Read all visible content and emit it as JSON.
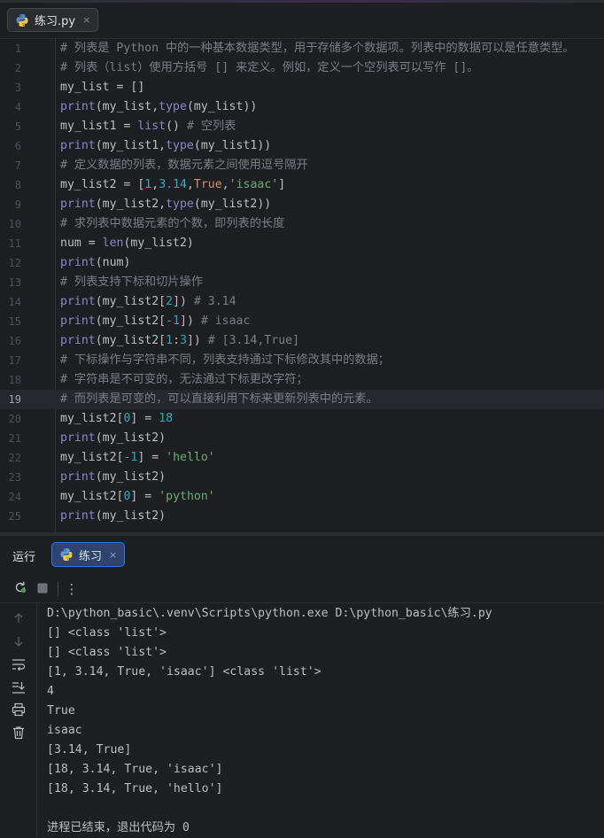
{
  "editor": {
    "tab_label": "练习.py",
    "tab_close": "×",
    "current_line": 19,
    "lines": [
      {
        "num": "1",
        "tokens": [
          {
            "t": "# 列表是 Python 中的一种基本数据类型，用于存储多个数据项。列表中的数据可以是任意类型。",
            "k": "c"
          }
        ]
      },
      {
        "num": "2",
        "tokens": [
          {
            "t": "# 列表（list）使用方括号 [] 来定义。例如，定义一个空列表可以写作 []。",
            "k": "c"
          }
        ]
      },
      {
        "num": "3",
        "tokens": [
          {
            "t": "my_list = []",
            "k": ""
          }
        ]
      },
      {
        "num": "4",
        "tokens": [
          {
            "t": "print",
            "k": "b"
          },
          {
            "t": "(my_list,",
            "k": ""
          },
          {
            "t": "type",
            "k": "b"
          },
          {
            "t": "(my_list))",
            "k": ""
          }
        ]
      },
      {
        "num": "5",
        "tokens": [
          {
            "t": "my_list1 = ",
            "k": ""
          },
          {
            "t": "list",
            "k": "b"
          },
          {
            "t": "() ",
            "k": ""
          },
          {
            "t": "# 空列表",
            "k": "c"
          }
        ]
      },
      {
        "num": "6",
        "tokens": [
          {
            "t": "print",
            "k": "b"
          },
          {
            "t": "(my_list1,",
            "k": ""
          },
          {
            "t": "type",
            "k": "b"
          },
          {
            "t": "(my_list1))",
            "k": ""
          }
        ]
      },
      {
        "num": "7",
        "tokens": [
          {
            "t": "# 定义数据的列表，数据元素之间使用逗号隔开",
            "k": "c"
          }
        ]
      },
      {
        "num": "8",
        "tokens": [
          {
            "t": "my_list2 = [",
            "k": ""
          },
          {
            "t": "1",
            "k": "n"
          },
          {
            "t": ",",
            "k": ""
          },
          {
            "t": "3.14",
            "k": "n"
          },
          {
            "t": ",",
            "k": ""
          },
          {
            "t": "True",
            "k": "k"
          },
          {
            "t": ",",
            "k": ""
          },
          {
            "t": "'isaac'",
            "k": "s"
          },
          {
            "t": "]",
            "k": ""
          }
        ]
      },
      {
        "num": "9",
        "tokens": [
          {
            "t": "print",
            "k": "b"
          },
          {
            "t": "(my_list2,",
            "k": ""
          },
          {
            "t": "type",
            "k": "b"
          },
          {
            "t": "(my_list2))",
            "k": ""
          }
        ]
      },
      {
        "num": "10",
        "tokens": [
          {
            "t": "# 求列表中数据元素的个数，即列表的长度",
            "k": "c"
          }
        ]
      },
      {
        "num": "11",
        "tokens": [
          {
            "t": "num = ",
            "k": ""
          },
          {
            "t": "len",
            "k": "b"
          },
          {
            "t": "(my_list2)",
            "k": ""
          }
        ]
      },
      {
        "num": "12",
        "tokens": [
          {
            "t": "print",
            "k": "b"
          },
          {
            "t": "(num)",
            "k": ""
          }
        ]
      },
      {
        "num": "13",
        "tokens": [
          {
            "t": "# 列表支持下标和切片操作",
            "k": "c"
          }
        ]
      },
      {
        "num": "14",
        "tokens": [
          {
            "t": "print",
            "k": "b"
          },
          {
            "t": "(my_list2[",
            "k": ""
          },
          {
            "t": "2",
            "k": "n"
          },
          {
            "t": "]) ",
            "k": ""
          },
          {
            "t": "# 3.14",
            "k": "c"
          }
        ]
      },
      {
        "num": "15",
        "tokens": [
          {
            "t": "print",
            "k": "b"
          },
          {
            "t": "(my_list2[",
            "k": ""
          },
          {
            "t": "-1",
            "k": "n"
          },
          {
            "t": "]) ",
            "k": ""
          },
          {
            "t": "# isaac",
            "k": "c"
          }
        ]
      },
      {
        "num": "16",
        "tokens": [
          {
            "t": "print",
            "k": "b"
          },
          {
            "t": "(my_list2[",
            "k": ""
          },
          {
            "t": "1",
            "k": "n"
          },
          {
            "t": ":",
            "k": ""
          },
          {
            "t": "3",
            "k": "n"
          },
          {
            "t": "]) ",
            "k": ""
          },
          {
            "t": "# [3.14,True]",
            "k": "c"
          }
        ]
      },
      {
        "num": "17",
        "tokens": [
          {
            "t": "# 下标操作与字符串不同，列表支持通过下标修改其中的数据；",
            "k": "c"
          }
        ]
      },
      {
        "num": "18",
        "tokens": [
          {
            "t": "# 字符串是不可变的，无法通过下标更改字符；",
            "k": "c"
          }
        ]
      },
      {
        "num": "19",
        "tokens": [
          {
            "t": "# 而列表是可变的，可以直接利用下标来更新列表中的元素。",
            "k": "c"
          }
        ]
      },
      {
        "num": "20",
        "tokens": [
          {
            "t": "my_list2[",
            "k": ""
          },
          {
            "t": "0",
            "k": "n"
          },
          {
            "t": "] = ",
            "k": ""
          },
          {
            "t": "18",
            "k": "n"
          }
        ]
      },
      {
        "num": "21",
        "tokens": [
          {
            "t": "print",
            "k": "b"
          },
          {
            "t": "(my_list2)",
            "k": ""
          }
        ]
      },
      {
        "num": "22",
        "tokens": [
          {
            "t": "my_list2[",
            "k": ""
          },
          {
            "t": "-1",
            "k": "n"
          },
          {
            "t": "] = ",
            "k": ""
          },
          {
            "t": "'hello'",
            "k": "s"
          }
        ]
      },
      {
        "num": "23",
        "tokens": [
          {
            "t": "print",
            "k": "b"
          },
          {
            "t": "(my_list2)",
            "k": ""
          }
        ]
      },
      {
        "num": "24",
        "tokens": [
          {
            "t": "my_list2[",
            "k": ""
          },
          {
            "t": "0",
            "k": "n"
          },
          {
            "t": "] = ",
            "k": ""
          },
          {
            "t": "'python'",
            "k": "s"
          }
        ]
      },
      {
        "num": "25",
        "tokens": [
          {
            "t": "print",
            "k": "b"
          },
          {
            "t": "(my_list2)",
            "k": ""
          }
        ]
      }
    ]
  },
  "run": {
    "title": "运行",
    "tab_label": "练习",
    "tab_close": "×",
    "toolbar": [
      {
        "name": "rerun-icon"
      },
      {
        "name": "stop-icon"
      },
      {
        "name": "more-options-icon",
        "glyph": "⋮"
      }
    ],
    "side_tools": [
      {
        "name": "scroll-up-icon"
      },
      {
        "name": "scroll-down-icon"
      },
      {
        "name": "soft-wrap-icon"
      },
      {
        "name": "scroll-to-end-icon"
      },
      {
        "name": "print-icon"
      },
      {
        "name": "clear-all-icon"
      }
    ],
    "output": [
      "D:\\python_basic\\.venv\\Scripts\\python.exe D:\\python_basic\\练习.py",
      "[] <class 'list'>",
      "[] <class 'list'>",
      "[1, 3.14, True, 'isaac'] <class 'list'>",
      "4",
      "True",
      "isaac",
      "[3.14, True]",
      "[18, 3.14, True, 'isaac']",
      "[18, 3.14, True, 'hello']",
      "",
      "进程已结束，退出代码为 0"
    ]
  },
  "colors": {
    "background": "#1e1f22",
    "comment": "#7a7e85",
    "builtin": "#8888c6",
    "number": "#2aacb8",
    "string": "#6aab73",
    "keyword": "#cf8e6d",
    "text": "#bcbec4",
    "run_tab_accent": "#3574f0"
  }
}
